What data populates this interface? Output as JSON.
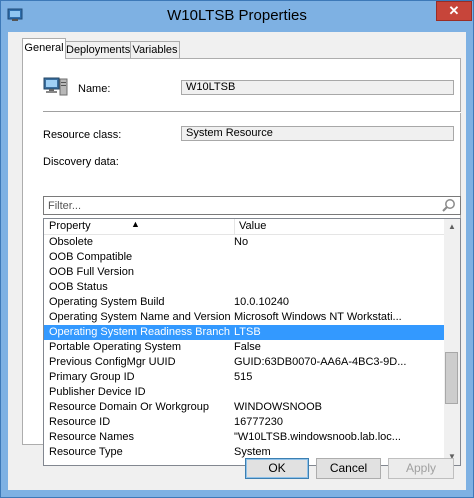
{
  "window": {
    "title": "W10LTSB Properties",
    "close_label": "✕"
  },
  "tabs": [
    {
      "label": "General"
    },
    {
      "label": "Deployments"
    },
    {
      "label": "Variables"
    }
  ],
  "general": {
    "name_label": "Name:",
    "name_value": "W10LTSB",
    "resource_class_label": "Resource class:",
    "resource_class_value": "System Resource",
    "discovery_label": "Discovery data:",
    "filter_placeholder": "Filter..."
  },
  "table": {
    "columns": [
      {
        "label": "Property",
        "sort": "ascending"
      },
      {
        "label": "Value"
      }
    ],
    "rows": [
      {
        "property": "Obsolete",
        "value": "No"
      },
      {
        "property": "OOB Compatible",
        "value": ""
      },
      {
        "property": "OOB Full Version",
        "value": ""
      },
      {
        "property": "OOB Status",
        "value": ""
      },
      {
        "property": "Operating System Build",
        "value": "10.0.10240"
      },
      {
        "property": "Operating System Name and Version",
        "value": "Microsoft Windows NT Workstati..."
      },
      {
        "property": "Operating System Readiness Branch",
        "value": "LTSB",
        "selected": true
      },
      {
        "property": "Portable Operating System",
        "value": "False"
      },
      {
        "property": "Previous ConfigMgr UUID",
        "value": "GUID:63DB0070-AA6A-4BC3-9D..."
      },
      {
        "property": "Primary Group ID",
        "value": "515"
      },
      {
        "property": "Publisher Device ID",
        "value": ""
      },
      {
        "property": "Resource Domain Or Workgroup",
        "value": "WINDOWSNOOB"
      },
      {
        "property": "Resource ID",
        "value": "16777230"
      },
      {
        "property": "Resource Names",
        "value": "\"W10LTSB.windowsnoob.lab.loc..."
      },
      {
        "property": "Resource Type",
        "value": "System"
      }
    ]
  },
  "buttons": {
    "ok": "OK",
    "cancel": "Cancel",
    "apply": "Apply"
  },
  "icons": {
    "title": "window-app-icon",
    "computer": "computer-icon",
    "search": "magnifier-icon"
  },
  "colors": {
    "selection": "#3399ff",
    "frame": "#7eb1e3",
    "close": "#c7453a"
  }
}
